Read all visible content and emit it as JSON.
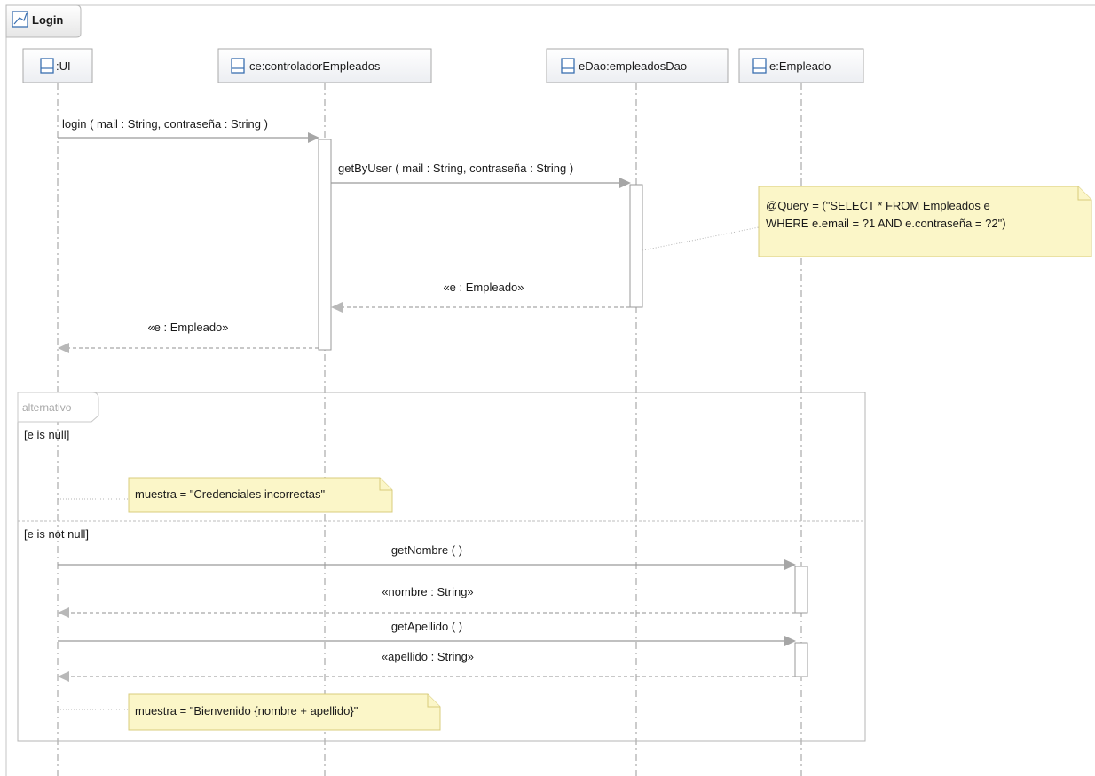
{
  "diagram_title": "Login",
  "lifelines": [
    {
      "id": "ui",
      "label": ":UI"
    },
    {
      "id": "ce",
      "label": "ce:controladorEmpleados"
    },
    {
      "id": "dao",
      "label": "eDao:empleadosDao"
    },
    {
      "id": "emp",
      "label": "e:Empleado"
    }
  ],
  "messages": {
    "login": "login ( mail : String, contraseña : String )",
    "getByUser": "getByUser ( mail : String, contraseña : String )",
    "ret_dao": "«e : Empleado»",
    "ret_ce": "«e : Empleado»",
    "getNombre": "getNombre ( )",
    "ret_nombre": "«nombre : String»",
    "getApellido": "getApellido ( )",
    "ret_apellido": "«apellido : String»"
  },
  "notes": {
    "query_line1": "@Query = (\"SELECT * FROM Empleados e",
    "query_line2": "WHERE e.email = ?1 AND e.contraseña = ?2\")",
    "incorrect": "muestra = \"Credenciales incorrectas\"",
    "welcome": "muestra = \"Bienvenido {nombre + apellido}\""
  },
  "fragment": {
    "keyword": "alternativo",
    "guard1": "[e is null]",
    "guard2": "[e is not null]"
  },
  "colors": {
    "note_fill": "#fbf6c8",
    "lifeline_icon": "#3a6fb0"
  }
}
